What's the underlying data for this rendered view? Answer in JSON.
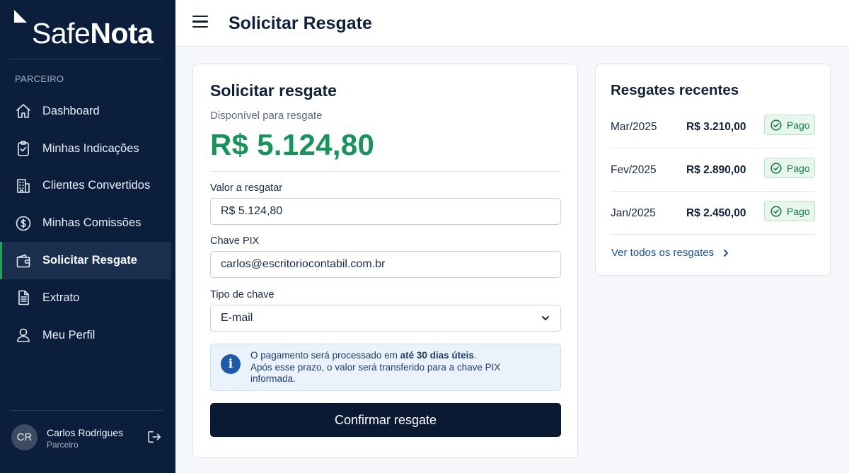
{
  "brand": {
    "light": "Safe",
    "bold": "Nota"
  },
  "sidebar": {
    "section_label": "PARCEIRO",
    "items": [
      {
        "label": "Dashboard",
        "icon": "home-icon"
      },
      {
        "label": "Minhas Indicações",
        "icon": "clipboard-check-icon"
      },
      {
        "label": "Clientes Convertidos",
        "icon": "building-icon"
      },
      {
        "label": "Minhas Comissões",
        "icon": "dollar-circle-icon"
      },
      {
        "label": "Solicitar Resgate",
        "icon": "wallet-icon",
        "active": true
      },
      {
        "label": "Extrato",
        "icon": "document-icon"
      },
      {
        "label": "Meu Perfil",
        "icon": "user-icon"
      }
    ],
    "user": {
      "initials": "CR",
      "name": "Carlos Rodrigues",
      "role": "Parceiro"
    }
  },
  "header": {
    "title": "Solicitar Resgate"
  },
  "form": {
    "title": "Solicitar resgate",
    "available_label": "Disponível para resgate",
    "available_value": "R$ 5.124,80",
    "amount_label": "Valor a resgatar",
    "amount_value": "R$ 5.124,80",
    "pix_label": "Chave PIX",
    "pix_value": "carlos@escritoriocontabil.com.br",
    "key_type_label": "Tipo de chave",
    "key_type_value": "E-mail",
    "info": {
      "line1_prefix": "O pagamento será processado em ",
      "line1_bold": "até 30 dias úteis",
      "line1_suffix": ".",
      "line2": "Após esse prazo, o valor será transferido para a chave PIX informada."
    },
    "confirm_label": "Confirmar resgate"
  },
  "recent": {
    "title": "Resgates recentes",
    "rows": [
      {
        "month": "Mar/2025",
        "amount": "R$ 3.210,00",
        "status": "Pago"
      },
      {
        "month": "Fev/2025",
        "amount": "R$ 2.890,00",
        "status": "Pago"
      },
      {
        "month": "Jan/2025",
        "amount": "R$ 2.450,00",
        "status": "Pago"
      }
    ],
    "see_all": "Ver todos os resgates"
  },
  "colors": {
    "sidebar_bg": "#0b1f3d",
    "accent_green": "#17935b",
    "button_dark": "#0b1a33",
    "active_indicator": "#22a05a"
  }
}
